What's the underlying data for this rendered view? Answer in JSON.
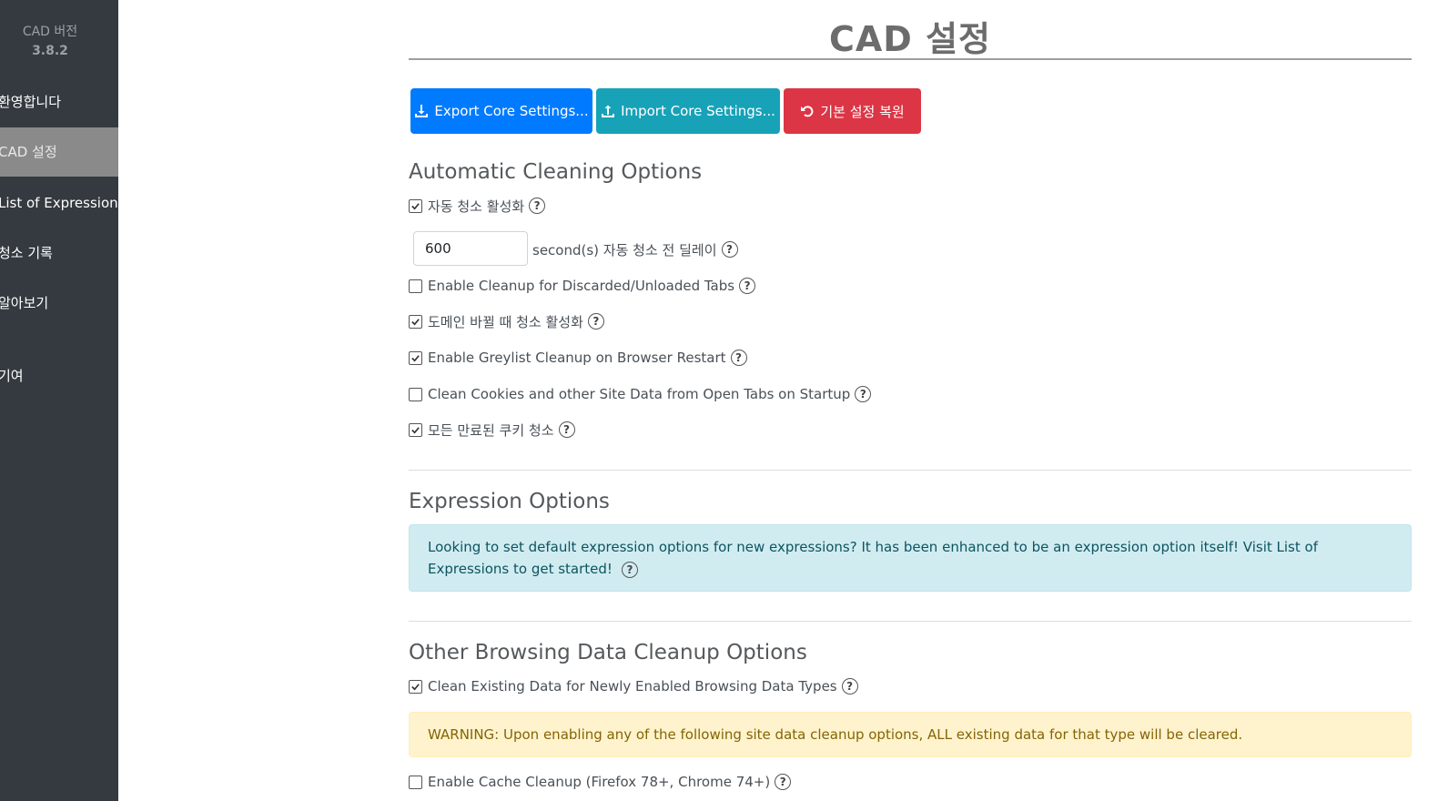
{
  "sidebar": {
    "version_label": "CAD 버전",
    "version_number": "3.8.2",
    "items": [
      {
        "label": "환영합니다"
      },
      {
        "label": "CAD 설정"
      },
      {
        "label": "List of Expressions"
      },
      {
        "label": "청소 기록"
      },
      {
        "label": "알아보기"
      },
      {
        "label": "기여"
      }
    ]
  },
  "main": {
    "title": "CAD 설정",
    "buttons": {
      "export_label": "Export Core Settings...",
      "import_label": "Import Core Settings...",
      "reset_label": "기본 설정 복원"
    },
    "auto_cleaning": {
      "title": "Automatic Cleaning Options",
      "enable_auto_clean": {
        "label": "자동 청소 활성화",
        "checked": true
      },
      "delay": {
        "value": "600",
        "suffix": "second(s) 자동 청소 전 딜레이"
      },
      "discarded_tabs": {
        "label": "Enable Cleanup for Discarded/Unloaded Tabs",
        "checked": false
      },
      "domain_change": {
        "label": "도메인 바뀔 때 청소 활성화",
        "checked": true
      },
      "greylist_restart": {
        "label": "Enable Greylist Cleanup on Browser Restart",
        "checked": true
      },
      "open_tabs_startup": {
        "label": "Clean Cookies and other Site Data from Open Tabs on Startup",
        "checked": false
      },
      "expired_cookies": {
        "label": "모든 만료된 쿠키 청소",
        "checked": true
      }
    },
    "expression_options": {
      "title": "Expression Options",
      "info": "Looking to set default expression options for new expressions? It has been enhanced to be an expression option itself! Visit List of Expressions to get started!"
    },
    "other_browsing": {
      "title": "Other Browsing Data Cleanup Options",
      "clean_existing": {
        "label": "Clean Existing Data for Newly Enabled Browsing Data Types",
        "checked": true
      },
      "warning": "WARNING: Upon enabling any of the following site data cleanup options, ALL existing data for that type will be cleared.",
      "cache_cleanup": {
        "label": "Enable Cache Cleanup (Firefox 78+, Chrome 74+)",
        "checked": false
      }
    },
    "help_symbol": "?"
  }
}
